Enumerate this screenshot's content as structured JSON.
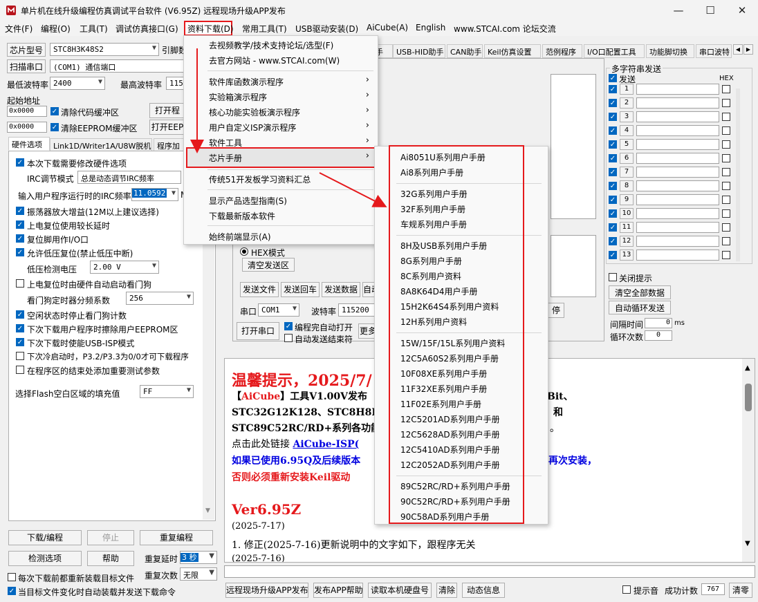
{
  "window": {
    "title": "单片机在线升级编程仿真调试平台软件 (V6.95Z) 远程现场升级APP发布",
    "minimize": "—",
    "maximize": "☐",
    "close": "✕"
  },
  "menubar": [
    "文件(F)",
    "编程(O)",
    "工具(T)",
    "调试仿真接口(G)",
    "资料下载(D)",
    "常用工具(T)",
    "USB驱动安装(D)",
    "AiCube(A)",
    "English",
    "www.STCAI.com 论坛交流"
  ],
  "left": {
    "chip_label": "芯片型号",
    "chip_value": "STC8H3K48S2",
    "cut_label": "引脚数",
    "scan_button": "扫描串口",
    "port_value": "(COM1) 通信端口",
    "min_baud_label": "最低波特率",
    "min_baud_value": "2400",
    "max_baud_label": "最高波特率",
    "max_baud_value": "1152",
    "start_addr_label": "起始地址",
    "addr1": "0x0000",
    "clear_code_label": "清除代码缓冲区",
    "open_prog_button": "打开程",
    "addr2": "0x0000",
    "clear_eeprom_label": "清除EEPROM缓冲区",
    "open_eeprom_button": "打开EEP",
    "tabs": [
      "硬件选项",
      "Link1D/Writer1A/U8W脱机",
      "程序加"
    ],
    "options": [
      {
        "text": "本次下载需要修改硬件选项",
        "checked": true
      },
      {
        "text": "上电复位使用较长延时",
        "checked": true
      },
      {
        "text": "复位脚用作I/O口",
        "checked": true
      },
      {
        "text": "允许低压复位(禁止低压中断)",
        "checked": true
      },
      {
        "text": "上电复位时由硬件自动启动看门狗",
        "checked": false
      },
      {
        "text": "空闲状态时停止看门狗计数",
        "checked": true
      },
      {
        "text": "下次下载用户程序时擦除用户EEPROM区",
        "checked": true
      },
      {
        "text": "下次下载时使能USB-ISP模式",
        "checked": true
      },
      {
        "text": "下次冷启动时，P3.2/P3.3为0/0才可下载程序",
        "checked": false
      },
      {
        "text": "在程序区的结束处添加重要测试参数",
        "checked": false
      }
    ],
    "amp_option": {
      "text": "振荡器放大增益(12M以上建议选择)",
      "checked": true
    },
    "irc_mode_label": "IRC调节模式",
    "irc_mode_value": "总是动态调节IRC频率",
    "irc_freq_label": "输入用户程序运行时的IRC频率",
    "irc_freq_value": "11.0592",
    "irc_freq_unit": "M",
    "lv_label": "低压检测电压",
    "lv_value": "2.00 V",
    "wdt_label": "看门狗定时器分频系数",
    "wdt_value": "256",
    "flash_fill_label": "选择Flash空白区域的填充值",
    "flash_fill_value": "FF",
    "download_button": "下载/编程",
    "stop_button": "停止",
    "reprog_button": "重复编程",
    "check_button": "检测选项",
    "help_button": "帮助",
    "repeat_delay_label": "重复延时",
    "repeat_delay_value": "3 秒",
    "repeat_count_label": "重复次数",
    "repeat_count_value": "无限",
    "reload_label": "每次下载前都重新装载目标文件",
    "auto_load_label": "当目标文件变化时自动装载并发送下载命令"
  },
  "right_tabs": [
    "手",
    "USB-HID助手",
    "CAN助手",
    "Keil仿真设置",
    "范例程序",
    "I/O口配置工具",
    "功能脚切换",
    "串口波特"
  ],
  "serial": {
    "hex_mode": "HEX模式",
    "clear_send": "清空发送区",
    "send_file": "发送文件",
    "send_enter": "发送回车",
    "send_data": "发送数据",
    "auto_cut": "自动",
    "port_label": "串口",
    "port_value": "COM1",
    "baud_label": "波特率",
    "baud_value": "115200",
    "open_port": "打开串口",
    "auto_open": "编程完自动打开",
    "auto_send_end": "自动发送结束符",
    "more": "更多",
    "stop_cut": "停"
  },
  "multi": {
    "group_title": "多字符串发送",
    "send_header": "发送",
    "hex_header": "HEX",
    "rows": [
      "1",
      "2",
      "3",
      "4",
      "5",
      "6",
      "7",
      "8",
      "9",
      "10",
      "11",
      "12",
      "13"
    ],
    "close_tip": "关闭提示",
    "clear_all": "清空全部数据",
    "auto_loop": "自动循环发送",
    "interval_label": "间隔时间",
    "interval_value": "0",
    "interval_unit": "ms",
    "loop_label": "循环次数",
    "loop_value": "0"
  },
  "news": {
    "line1": "温馨提示，2025/7/",
    "line2_a": "【",
    "line2_b": "AiCube",
    "line2_c": "】工具V1.00V发布",
    "line2_tail": "Bit、",
    "line3": "STC32G12K128、STC8H8K64",
    "line3_tail": "和",
    "line4": "STC89C52RC/RD+系列各功能",
    "line4_tail": "。",
    "line5_a": "点击此处链接 ",
    "line5_b": "AiCube-ISP(",
    "line6": "如果已使用6.95Q及后续版本",
    "line6_tail": "再次安装，",
    "line7": "否则必须重新安装Keil驱动",
    "ver": "Ver6.95Z",
    "date1": "(2025-7-17)",
    "fix": "1. 修正(2025-7-16)更新说明中的文字如下，跟程序无关",
    "date2": "(2025-7-16)"
  },
  "bottom": {
    "b1": "远程现场升级APP发布",
    "b2": "发布APP帮助",
    "b3": "读取本机硬盘号",
    "b4": "清除",
    "b5": "动态信息",
    "sound_label": "提示音",
    "success_label": "成功计数",
    "success_value": "767",
    "clear_count": "清零"
  },
  "dropdown": {
    "items": [
      "去视频教学/技术支持论坛/选型(F)",
      "去官方网站 - www.STCAI.com(W)",
      "软件库函数演示程序",
      "实验箱演示程序",
      "核心功能实验板演示程序",
      "用户自定义ISP演示程序",
      "软件工具",
      "芯片手册",
      "传统51开发板学习资料汇总",
      "显示产品选型指南(S)",
      "下载最新版本软件",
      "始终前端显示(A)"
    ],
    "submenu_arrow": "›"
  },
  "submenu": {
    "groups": [
      [
        "Ai8051U系列用户手册",
        "Ai8系列用户手册"
      ],
      [
        "32G系列用户手册",
        "32F系列用户手册",
        "车规系列用户手册"
      ],
      [
        "8H及USB系列用户手册",
        "8G系列用户手册",
        "8C系列用户资料",
        "8A8K64D4用户手册",
        "15H2K64S4系列用户资料",
        "12H系列用户资料"
      ],
      [
        "15W/15F/15L系列用户资料",
        "12C5A60S2系列用户手册",
        "10F08XE系列用户手册",
        "11F32XE系列用户手册",
        "11F02E系列用户手册",
        "12C5201AD系列用户手册",
        "12C5628AD系列用户手册",
        "12C5410AD系列用户手册",
        "12C2052AD系列用户手册"
      ],
      [
        "89C52RC/RD+系列用户手册",
        "90C52RC/RD+系列用户手册",
        "90C58AD系列用户手册"
      ]
    ]
  },
  "colors": {
    "annotation_red": "#e5191c",
    "check_blue": "#0067c0",
    "news_red": "#e5191c",
    "news_blue": "#0000e0"
  }
}
